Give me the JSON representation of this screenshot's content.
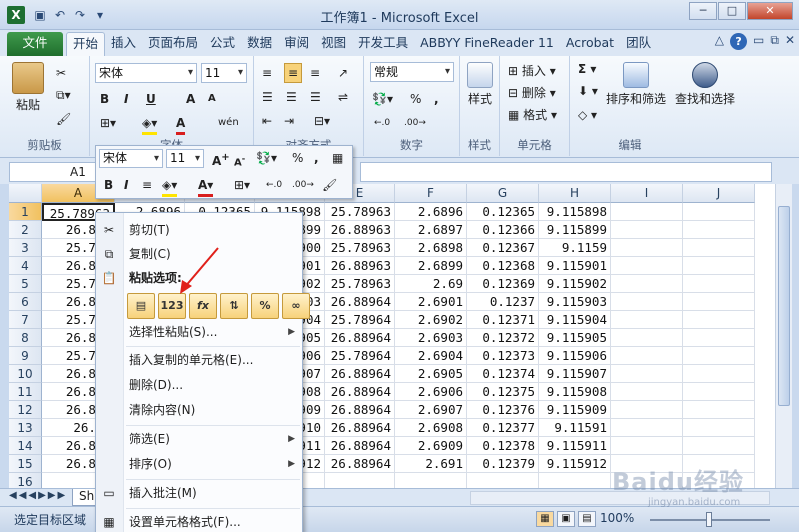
{
  "window": {
    "title": "工作簿1 - Microsoft Excel",
    "min": "─",
    "max": "□",
    "close": "✕"
  },
  "tabs": [
    "文件",
    "开始",
    "插入",
    "页面布局",
    "公式",
    "数据",
    "审阅",
    "视图",
    "开发工具",
    "ABBYY FineReader 11",
    "Acrobat",
    "团队"
  ],
  "ribbon": {
    "clipboard": {
      "label": "剪贴板",
      "paste": "粘贴"
    },
    "font": {
      "label": "字体",
      "name": "宋体",
      "size": "11",
      "bold": "B",
      "italic": "I",
      "underline": "U",
      "grow": "A",
      "shrink": "A",
      "color": "A"
    },
    "alignment": {
      "label": "对齐方式"
    },
    "number": {
      "label": "数字",
      "format": "常规",
      "percent": "%",
      "comma": ","
    },
    "styles": {
      "label": "样式",
      "button": "样式"
    },
    "cells": {
      "label": "单元格",
      "insert": "插入",
      "delete": "删除",
      "format": "格式"
    },
    "editing": {
      "label": "编辑",
      "sort": "排序和筛选",
      "find": "查找和选择"
    }
  },
  "formula": {
    "namebox": "A1"
  },
  "columns": [
    "A",
    "B",
    "C",
    "D",
    "E",
    "F",
    "G",
    "H",
    "I",
    "J"
  ],
  "rows": [
    "1",
    "2",
    "3",
    "4",
    "5",
    "6",
    "7",
    "8",
    "9",
    "10",
    "11",
    "12",
    "13",
    "14",
    "15",
    "16"
  ],
  "cells": {
    "a": [
      "25.78963",
      "26.889",
      "25.789",
      "26.889",
      "25.789",
      "26.889",
      "25.789",
      "26.889",
      "25.789",
      "26.889",
      "26.889",
      "26.889",
      "26.88",
      "26.889",
      "26.889",
      ""
    ],
    "b": [
      "2.6896",
      "",
      "",
      "",
      "",
      "",
      "",
      "",
      "",
      "",
      "",
      "",
      "",
      "",
      "",
      ""
    ],
    "c": [
      "0.12365",
      "",
      "",
      "",
      "",
      "",
      "",
      "",
      "",
      "",
      "",
      "",
      "",
      "",
      "",
      ""
    ],
    "d": [
      "9.115898",
      "5899",
      "5900",
      "5901",
      "5902",
      "5903",
      "5904",
      "5905",
      "5906",
      "5907",
      "5908",
      "5909",
      "5910",
      "5911",
      "5912",
      ""
    ],
    "e": [
      "25.78963",
      "26.88963",
      "25.78963",
      "26.88963",
      "25.78963",
      "26.88964",
      "25.78964",
      "26.88964",
      "25.78964",
      "26.88964",
      "26.88964",
      "26.88964",
      "26.88964",
      "26.88964",
      "26.88964",
      ""
    ],
    "f": [
      "2.6896",
      "2.6897",
      "2.6898",
      "2.6899",
      "2.69",
      "2.6901",
      "2.6902",
      "2.6903",
      "2.6904",
      "2.6905",
      "2.6906",
      "2.6907",
      "2.6908",
      "2.6909",
      "2.691",
      ""
    ],
    "g": [
      "0.12365",
      "0.12366",
      "0.12367",
      "0.12368",
      "0.12369",
      "0.1237",
      "0.12371",
      "0.12372",
      "0.12373",
      "0.12374",
      "0.12375",
      "0.12376",
      "0.12377",
      "0.12378",
      "0.12379",
      ""
    ],
    "h": [
      "9.115898",
      "9.115899",
      "9.1159",
      "9.115901",
      "9.115902",
      "9.115903",
      "9.115904",
      "9.115905",
      "9.115906",
      "9.115907",
      "9.115908",
      "9.115909",
      "9.11591",
      "9.115911",
      "9.115912",
      ""
    ]
  },
  "minitoolbar": {
    "font": "宋体",
    "size": "11"
  },
  "contextmenu": {
    "cut": "剪切(T)",
    "copy": "复制(C)",
    "paste_options": "粘贴选项:",
    "paste_special": "选择性粘贴(S)...",
    "insert_copied": "插入复制的单元格(E)...",
    "delete": "删除(D)...",
    "clear": "清除内容(N)",
    "filter": "筛选(E)",
    "sort": "排序(O)",
    "comment": "插入批注(M)",
    "format_cells": "设置单元格格式(F)..."
  },
  "sheet": {
    "tab": "Sh"
  },
  "status": {
    "text": "选定目标区域",
    "zoom": "100%"
  },
  "watermark": {
    "main": "Baidu经验",
    "sub": "jingyan.baidu.com"
  }
}
